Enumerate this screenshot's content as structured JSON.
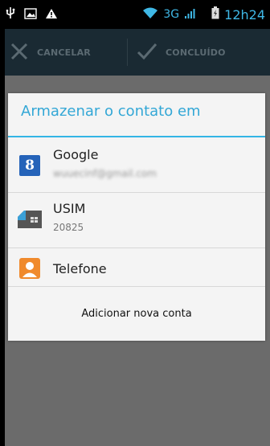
{
  "status_bar": {
    "network": "3G",
    "time": "12h24"
  },
  "action_bar": {
    "cancel_label": "CANCELAR",
    "done_label": "CONCLUÍDO"
  },
  "dialog": {
    "title": "Armazenar o contato em",
    "accounts": [
      {
        "name": "Google",
        "detail": "wuuecinf@gmail.com",
        "icon": "google-icon"
      },
      {
        "name": "USIM",
        "detail": "20825",
        "icon": "sim-card-icon"
      },
      {
        "name": "Telefone",
        "detail": "",
        "icon": "phone-contact-icon"
      }
    ],
    "add_account_label": "Adicionar nova conta"
  },
  "colors": {
    "accent": "#33b5e5",
    "action_bar": "#1a2a33",
    "google_blue": "#2563b9",
    "phone_orange": "#f08a2c"
  }
}
